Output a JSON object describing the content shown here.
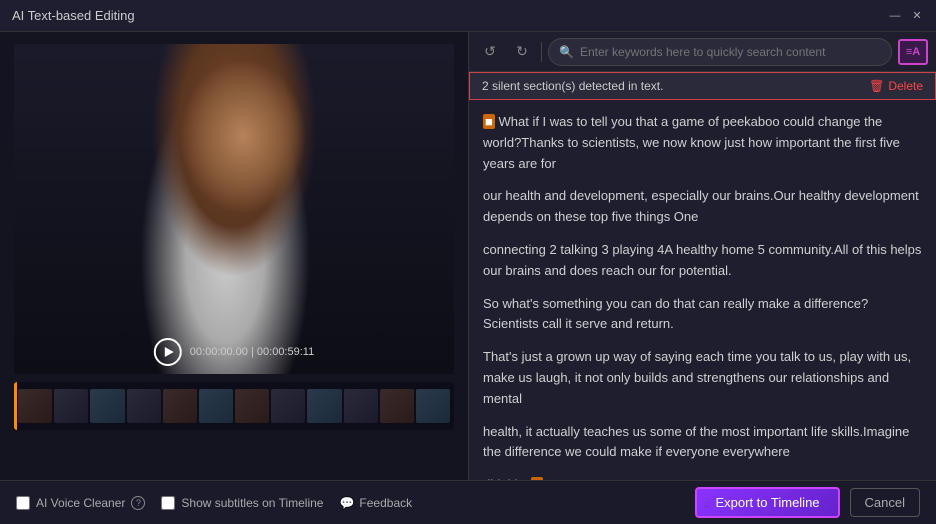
{
  "titlebar": {
    "title": "AI Text-based Editing",
    "minimize_label": "—",
    "close_label": "✕"
  },
  "toolbar": {
    "undo_label": "↺",
    "redo_label": "↻",
    "search_placeholder": "Enter keywords here to quickly search content",
    "format_label": "≡A"
  },
  "silent_banner": {
    "message": "2 silent section(s) detected in text.",
    "delete_label": "Delete"
  },
  "text_content": {
    "paragraphs": [
      {
        "id": 1,
        "has_highlight_start": true,
        "text_before": "",
        "text": "What if I was to tell you that a game of peekaboo could change the world?Thanks to scientists, we now know just how important the first five years are for"
      },
      {
        "id": 2,
        "has_highlight_start": false,
        "text": "our health and development, especially our brains.Our healthy development depends on these top five things One"
      },
      {
        "id": 3,
        "has_highlight_start": false,
        "text": "connecting 2 talking 3 playing 4A healthy home 5 community.All of this helps our brains and does reach our for potential."
      },
      {
        "id": 4,
        "has_highlight_start": false,
        "text": "So what's something you can do that can really make a difference?Scientists call it serve and return."
      },
      {
        "id": 5,
        "has_highlight_start": false,
        "text": "That's just a grown up way of saying each time you talk to us, play with us, make us laugh, it not only builds and strengthens our relationships and mental"
      },
      {
        "id": 6,
        "has_highlight_start": false,
        "text": "health, it actually teaches us some of the most important life skills.Imagine the difference we could make if everyone everywhere"
      },
      {
        "id": 7,
        "has_highlight_start": false,
        "has_highlight_end": true,
        "text": "did this."
      }
    ]
  },
  "video": {
    "current_time": "00:00:00.00",
    "total_time": "00:00:59:11"
  },
  "footer": {
    "voice_cleaner_label": "AI Voice Cleaner",
    "subtitles_label": "Show subtitles on Timeline",
    "feedback_label": "Feedback",
    "export_label": "Export to Timeline",
    "cancel_label": "Cancel"
  }
}
